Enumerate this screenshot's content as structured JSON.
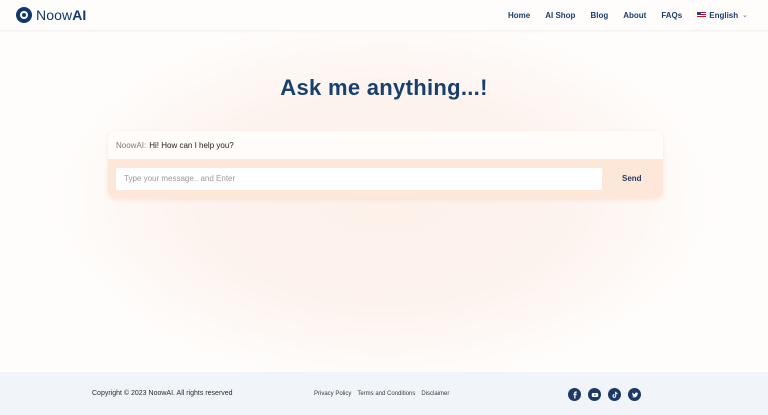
{
  "brand": {
    "name_prefix": "Noow",
    "name_suffix": "AI"
  },
  "nav": {
    "items": [
      {
        "label": "Home"
      },
      {
        "label": "AI Shop"
      },
      {
        "label": "Blog"
      },
      {
        "label": "About"
      },
      {
        "label": "FAQs"
      }
    ],
    "language": "English",
    "language_icon": "us-flag-icon"
  },
  "main": {
    "title": "Ask me anything...!",
    "chat": {
      "sender": "NoowAI:",
      "greeting": "Hi! How can I help you?",
      "input_placeholder": "Type your message.. and Enter",
      "input_value": "",
      "send_label": "Send"
    }
  },
  "footer": {
    "copyright": "Copyright © 2023 NoowAI. All rights reserved",
    "links": [
      "Privacy Policy",
      "Terms and Conditions",
      "Disclaimer"
    ],
    "socials": [
      "facebook-icon",
      "youtube-icon",
      "tiktok-icon",
      "twitter-icon"
    ]
  },
  "colors": {
    "brand": "#13396b",
    "chat_accent": "#fde7d9",
    "footer_bg": "#f1f5fa"
  }
}
